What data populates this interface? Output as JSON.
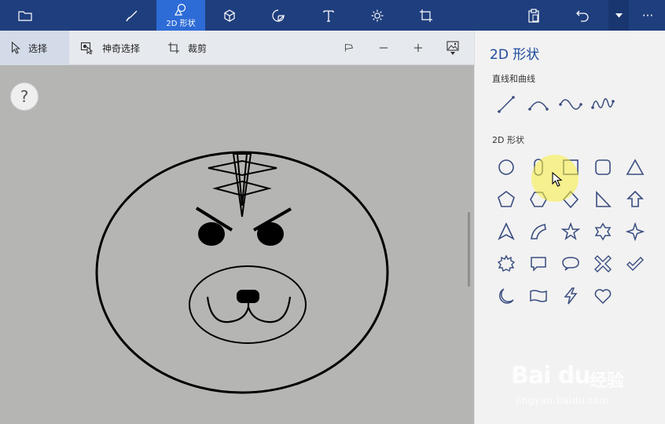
{
  "topbar": {
    "active_tab_label": "2D 形状",
    "tabs": [
      "folder-icon",
      "brushes-icon",
      "2d-shapes-icon",
      "3d-shapes-icon",
      "stickers-icon",
      "text-icon",
      "effects-icon",
      "canvas-icon"
    ],
    "right_actions": [
      "paste-icon",
      "undo-icon",
      "history-icon",
      "more-icon"
    ],
    "more_label": "···"
  },
  "toolbar": {
    "select_label": "选择",
    "magic_select_label": "神奇选择",
    "crop_label": "裁剪"
  },
  "canvas": {
    "help_label": "?"
  },
  "panel": {
    "title": "2D 形状",
    "lines_section": "直线和曲线",
    "shapes_section": "2D 形状",
    "lines": [
      "line",
      "curve-2pt",
      "curve-3pt",
      "curve-4pt"
    ],
    "shapes": [
      [
        "circle",
        "rounded-pill",
        "square",
        "rounded-square",
        "triangle"
      ],
      [
        "pentagon",
        "hexagon",
        "diamond",
        "right-triangle",
        "arrow-up"
      ],
      [
        "arrow-head",
        "quarter-circle",
        "star-5",
        "star-6",
        "star-4"
      ],
      [
        "burst",
        "speech-rect",
        "speech-oval",
        "x-mark",
        "check-mark"
      ],
      [
        "moon",
        "banner",
        "lightning",
        "heart"
      ]
    ],
    "line_color": "#3a4d80"
  },
  "watermark": {
    "logo": "Bai du",
    "cn": "经验",
    "url": "jingyan.baidu.com"
  }
}
